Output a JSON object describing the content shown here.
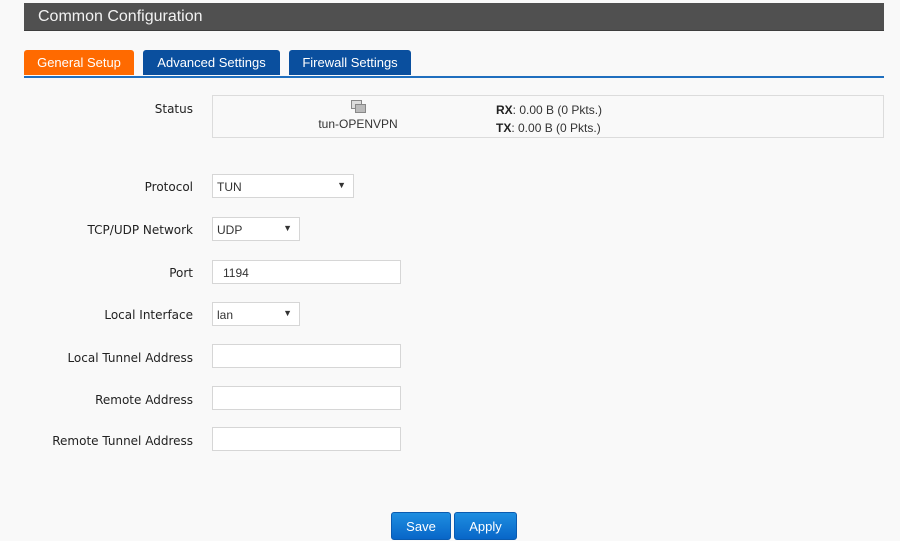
{
  "header": {
    "title": "Common Configuration"
  },
  "tabs": [
    {
      "label": "General Setup",
      "active": true
    },
    {
      "label": "Advanced Settings",
      "active": false
    },
    {
      "label": "Firewall Settings",
      "active": false
    }
  ],
  "status": {
    "label": "Status",
    "interface_icon": "network-interface-icon",
    "interface_name": "tun-OPENVPN",
    "rx_label": "RX",
    "rx_value": ": 0.00 B (0 Pkts.)",
    "tx_label": "TX",
    "tx_value": ": 0.00 B (0 Pkts.)"
  },
  "form": {
    "protocol": {
      "label": "Protocol",
      "value": "TUN"
    },
    "network": {
      "label": "TCP/UDP Network",
      "value": "UDP"
    },
    "port": {
      "label": "Port",
      "value": "1194"
    },
    "local_interface": {
      "label": "Local Interface",
      "value": "lan"
    },
    "local_tunnel_address": {
      "label": "Local Tunnel Address",
      "value": ""
    },
    "remote_address": {
      "label": "Remote Address",
      "value": ""
    },
    "remote_tunnel_address": {
      "label": "Remote Tunnel Address",
      "value": ""
    },
    "dropdown_arrow": "▼"
  },
  "actions": {
    "save": "Save",
    "apply": "Apply"
  }
}
